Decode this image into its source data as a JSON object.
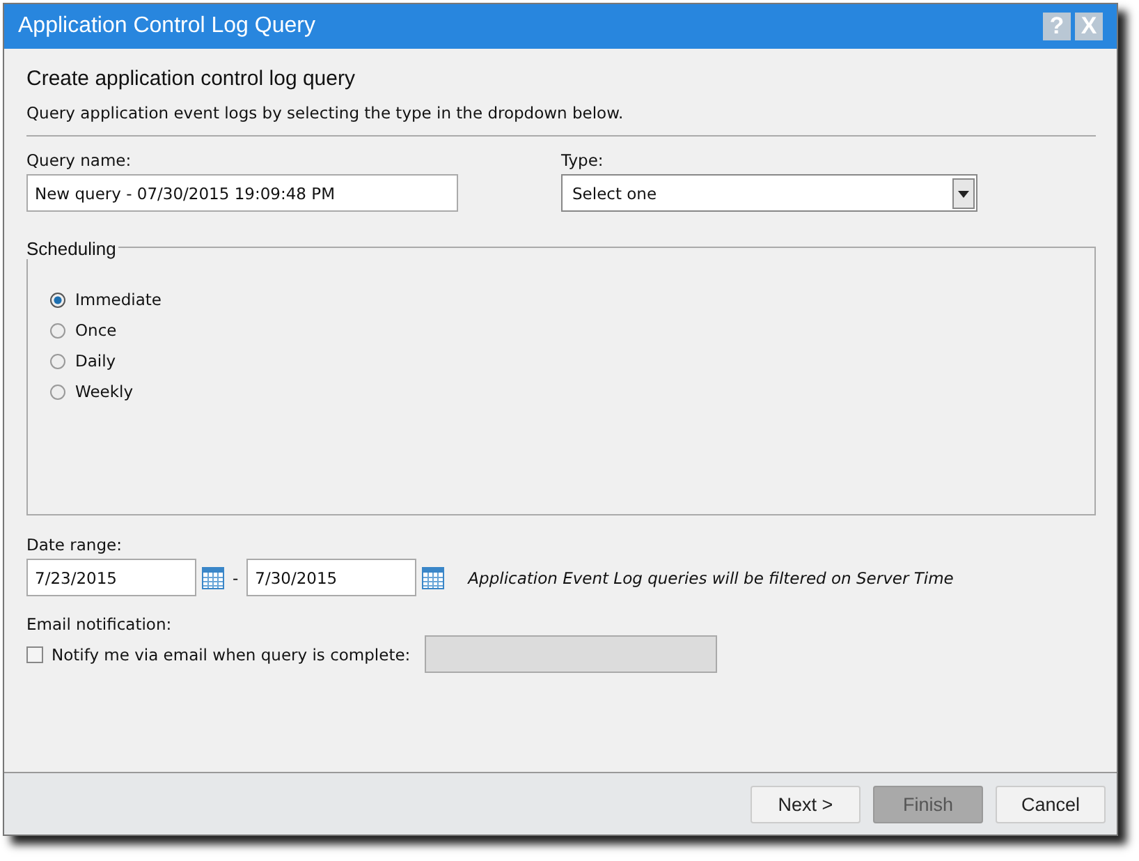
{
  "window": {
    "title": "Application Control Log Query",
    "help_button": "?",
    "close_button": "X"
  },
  "heading": "Create application control log query",
  "description": "Query application event logs by selecting the type in the dropdown below.",
  "query_name": {
    "label": "Query name:",
    "value": "New query - 07/30/2015 19:09:48 PM"
  },
  "type": {
    "label": "Type:",
    "value": "Select one"
  },
  "scheduling": {
    "legend": "Scheduling",
    "options": [
      {
        "label": "Immediate",
        "selected": true
      },
      {
        "label": "Once",
        "selected": false
      },
      {
        "label": "Daily",
        "selected": false
      },
      {
        "label": "Weekly",
        "selected": false
      }
    ]
  },
  "date_range": {
    "label": "Date range:",
    "from": "7/23/2015",
    "separator": "-",
    "to": "7/30/2015",
    "note": "Application Event Log queries will be filtered on Server Time"
  },
  "email": {
    "label": "Email notification:",
    "checkbox_label": "Notify me via email when query is complete:",
    "checked": false,
    "address_disabled": true
  },
  "buttons": [
    {
      "label": "Next >",
      "disabled": false
    },
    {
      "label": "Finish",
      "disabled": true
    },
    {
      "label": "Cancel",
      "disabled": false
    }
  ]
}
